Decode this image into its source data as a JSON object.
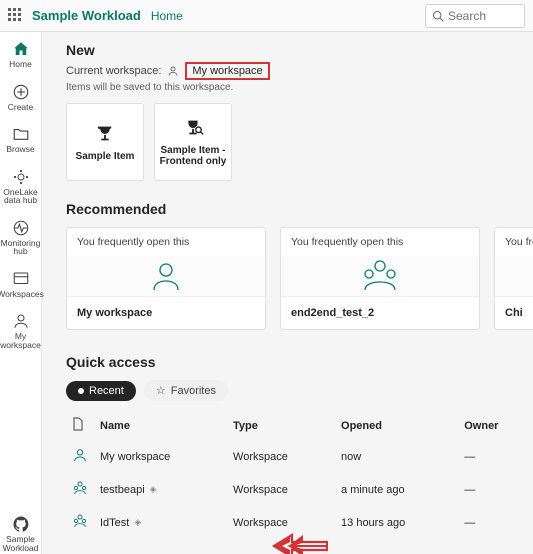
{
  "topbar": {
    "brand": "Sample Workload",
    "crumb": "Home",
    "search_placeholder": "Search"
  },
  "rail": {
    "home": "Home",
    "create": "Create",
    "browse": "Browse",
    "datahub": "OneLake data hub",
    "monitoring": "Monitoring hub",
    "workspaces": "Workspaces",
    "myws": "My workspace",
    "sample": "Sample Workload"
  },
  "new_section": {
    "title": "New",
    "current_label": "Current workspace:",
    "current_ws": "My workspace",
    "hint": "Items will be saved to this workspace.",
    "cards": {
      "sample_item": "Sample Item",
      "sample_item_fe": "Sample Item - Frontend only"
    }
  },
  "recommended": {
    "title": "Recommended",
    "freq": "You frequently open this",
    "cards": [
      "My workspace",
      "end2end_test_2",
      "Chi"
    ]
  },
  "quick_access": {
    "title": "Quick access",
    "recent": "Recent",
    "favorites": "Favorites",
    "columns": {
      "name": "Name",
      "type": "Type",
      "opened": "Opened",
      "owner": "Owner"
    },
    "rows": [
      {
        "name": "My workspace",
        "type": "Workspace",
        "opened": "now",
        "owner": "—",
        "icon": "person"
      },
      {
        "name": "testbeapi",
        "type": "Workspace",
        "opened": "a minute ago",
        "owner": "—",
        "icon": "ws",
        "diamond": true
      },
      {
        "name": "IdTest",
        "type": "Workspace",
        "opened": "13 hours ago",
        "owner": "—",
        "icon": "ws",
        "diamond": true
      }
    ]
  }
}
